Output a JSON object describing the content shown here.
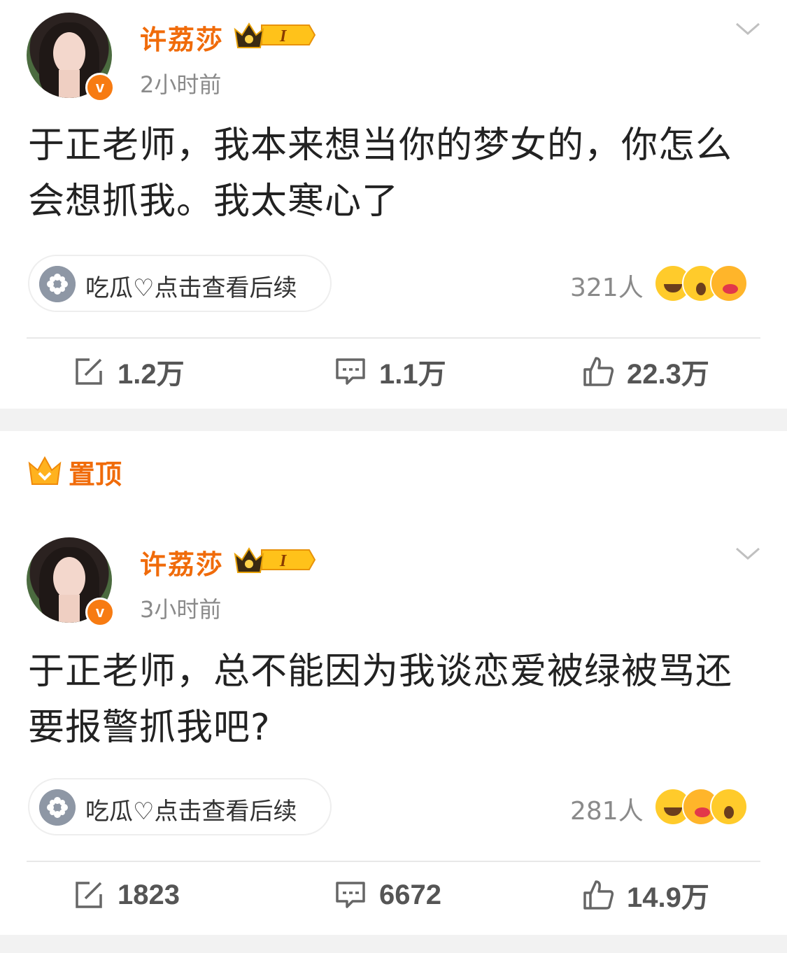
{
  "posts": [
    {
      "username": "许荔莎",
      "level": "I",
      "verified_mark": "v",
      "time": "2小时前",
      "content": "于正老师，我本来想当你的梦女的，你怎么会想抓我。我太寒心了",
      "follow_pill": "吃瓜♡点击查看后续",
      "reaction_count": "321人",
      "reaction_icons": [
        "grin-emoji",
        "surprised-emoji",
        "blush-emoji"
      ],
      "repost": "1.2万",
      "comment": "1.1万",
      "like": "22.3万"
    },
    {
      "username": "许荔莎",
      "level": "I",
      "verified_mark": "v",
      "time": "3小时前",
      "content": "于正老师，总不能因为我谈恋爱被绿被骂还要报警抓我吧?",
      "follow_pill": "吃瓜♡点击查看后续",
      "reaction_count": "281人",
      "reaction_icons": [
        "grin-emoji",
        "blush-emoji",
        "surprised-emoji"
      ],
      "repost": "1823",
      "comment": "6672",
      "like": "14.9万"
    }
  ],
  "pinned_label": "置顶",
  "colors": {
    "brand_orange": "#f06b0a",
    "muted_text": "#8a8a8a",
    "separator": "#f2f2f2"
  }
}
